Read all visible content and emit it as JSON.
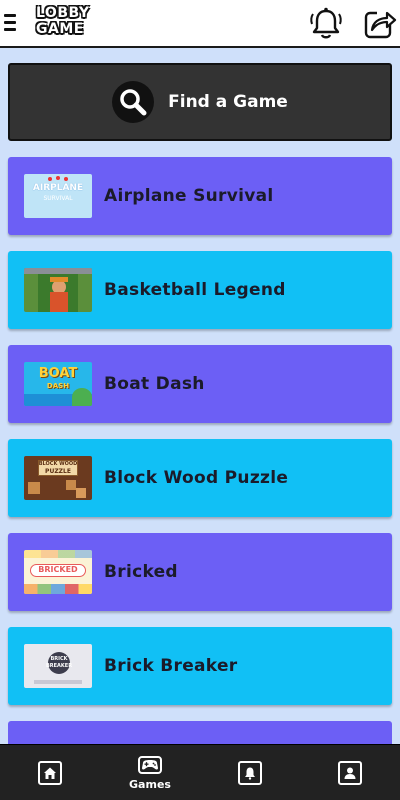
{
  "header": {
    "logo_line1": "LOBBY",
    "logo_line2": "GAME"
  },
  "find_game": {
    "label": "Find a Game"
  },
  "games": [
    {
      "title": "Airplane Survival",
      "card_color": "#6c5ff5",
      "thumb_text": "AIRPLANE",
      "thumb_subtext": "SURVIVAL"
    },
    {
      "title": "Basketball Legend",
      "card_color": "#11c0f5"
    },
    {
      "title": "Boat Dash",
      "card_color": "#6c5ff5",
      "thumb_text": "BOAT",
      "thumb_subtext": "DASH"
    },
    {
      "title": "Block Wood Puzzle",
      "card_color": "#11c0f5",
      "thumb_text": "BLOCK WOOD",
      "thumb_subtext": "PUZZLE"
    },
    {
      "title": "Bricked",
      "card_color": "#6c5ff5",
      "thumb_text": "BRICKED"
    },
    {
      "title": "Brick Breaker",
      "card_color": "#11c0f5",
      "thumb_text": "BRICK",
      "thumb_subtext": "BREAKER"
    }
  ],
  "bottom_nav": {
    "items": [
      {
        "icon": "home-icon",
        "label": ""
      },
      {
        "icon": "gamepad-icon",
        "label": "Games"
      },
      {
        "icon": "bell-icon",
        "label": ""
      },
      {
        "icon": "profile-icon",
        "label": ""
      }
    ]
  },
  "colors": {
    "background": "#cfe0fa",
    "purple_card": "#6c5ff5",
    "cyan_card": "#11c0f5",
    "dark_card": "#333333",
    "nav_bg": "#222222"
  }
}
